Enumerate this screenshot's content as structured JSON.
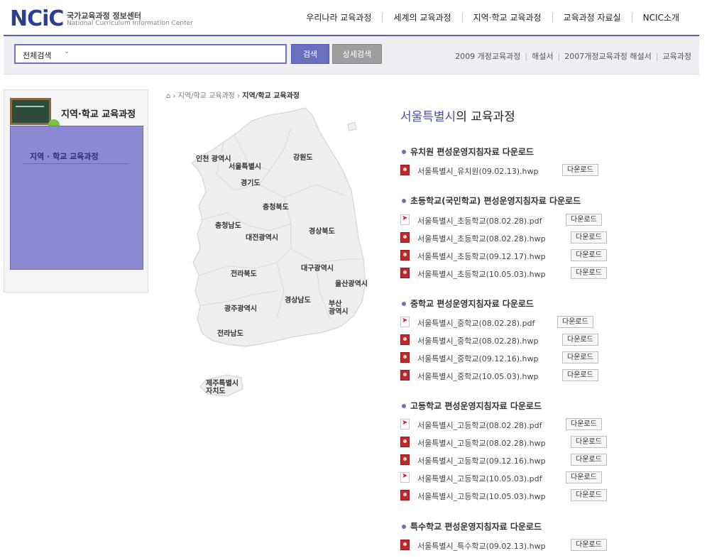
{
  "header": {
    "logo_mark": "NCiC",
    "logo_ko": "국가교육과정 정보센터",
    "logo_en": "National Curriculum Information Center",
    "nav": [
      "우리나라 교육과정",
      "세계의 교육과정",
      "지역·학교 교육과정",
      "교육과정 자료실",
      "NCIC소개"
    ]
  },
  "search": {
    "scope": "전체검색",
    "placeholder": "",
    "search_label": "검색",
    "advanced_label": "상세검색",
    "quick_links": [
      "2009 개정교육과정",
      "해설서",
      "2007개정교육과정 해설서",
      "교육과정"
    ]
  },
  "sidebar": {
    "title": "지역·학교 교육과정",
    "item": "지역 · 학교 교육과정"
  },
  "breadcrumb": {
    "home_icon": "home-icon",
    "path": [
      "지역/학교 교육과정"
    ],
    "current": "지역/학교 교육과정"
  },
  "map": {
    "regions": [
      "인천 광역시",
      "서울특별시",
      "강원도",
      "경기도",
      "충청북도",
      "충청남도",
      "대전광역시",
      "경상북도",
      "전라북도",
      "대구광역시",
      "울산광역시",
      "경상남도",
      "부산 광역시",
      "광주광역시",
      "전라남도",
      "제주특별시 자치도"
    ]
  },
  "content": {
    "title_highlight": "서울특별시",
    "title_suffix": "의 교육과정",
    "download_label": "다운로드",
    "sections": [
      {
        "title": "유치원 편성운영지침자료 다운로드",
        "files": [
          {
            "name": "서울특별시_유치원(09.02.13).hwp",
            "type": "hwp"
          }
        ]
      },
      {
        "title": "초등학교(국민학교) 편성운영지침자료 다운로드",
        "files": [
          {
            "name": "서울특별시_초등학교(08.02.28).pdf",
            "type": "pdf"
          },
          {
            "name": "서울특별시_초등학교(08.02.28).hwp",
            "type": "hwp"
          },
          {
            "name": "서울특별시_초등학교(09.12.17).hwp",
            "type": "hwp"
          },
          {
            "name": "서울특별시_초등학교(10.05.03).hwp",
            "type": "hwp"
          }
        ]
      },
      {
        "title": "중학교 편성운영지침자료 다운로드",
        "files": [
          {
            "name": "서울특별시_중학교(08.02.28).pdf",
            "type": "pdf"
          },
          {
            "name": "서울특별시_중학교(08.02.28).hwp",
            "type": "hwp"
          },
          {
            "name": "서울특별시_중학교(09.12.16).hwp",
            "type": "hwp"
          },
          {
            "name": "서울특별시_중학교(10.05.03).hwp",
            "type": "hwp"
          }
        ]
      },
      {
        "title": "고등학교 편성운영지침자료 다운로드",
        "files": [
          {
            "name": "서울특별시_고등학교(08.02.28).pdf",
            "type": "pdf"
          },
          {
            "name": "서울특별시_고등학교(08.02.28).hwp",
            "type": "hwp"
          },
          {
            "name": "서울특별시_고등학교(09.12.16).hwp",
            "type": "hwp"
          },
          {
            "name": "서울특별시_고등학교(10.05.03).pdf",
            "type": "pdf"
          },
          {
            "name": "서울특별시_고등학교(10.05.03).hwp",
            "type": "hwp"
          }
        ]
      },
      {
        "title": "특수학교 편성운영지침자료 다운로드",
        "files": [
          {
            "name": "서울특별시_특수학교(09.02.13).hwp",
            "type": "hwp"
          }
        ]
      }
    ]
  }
}
